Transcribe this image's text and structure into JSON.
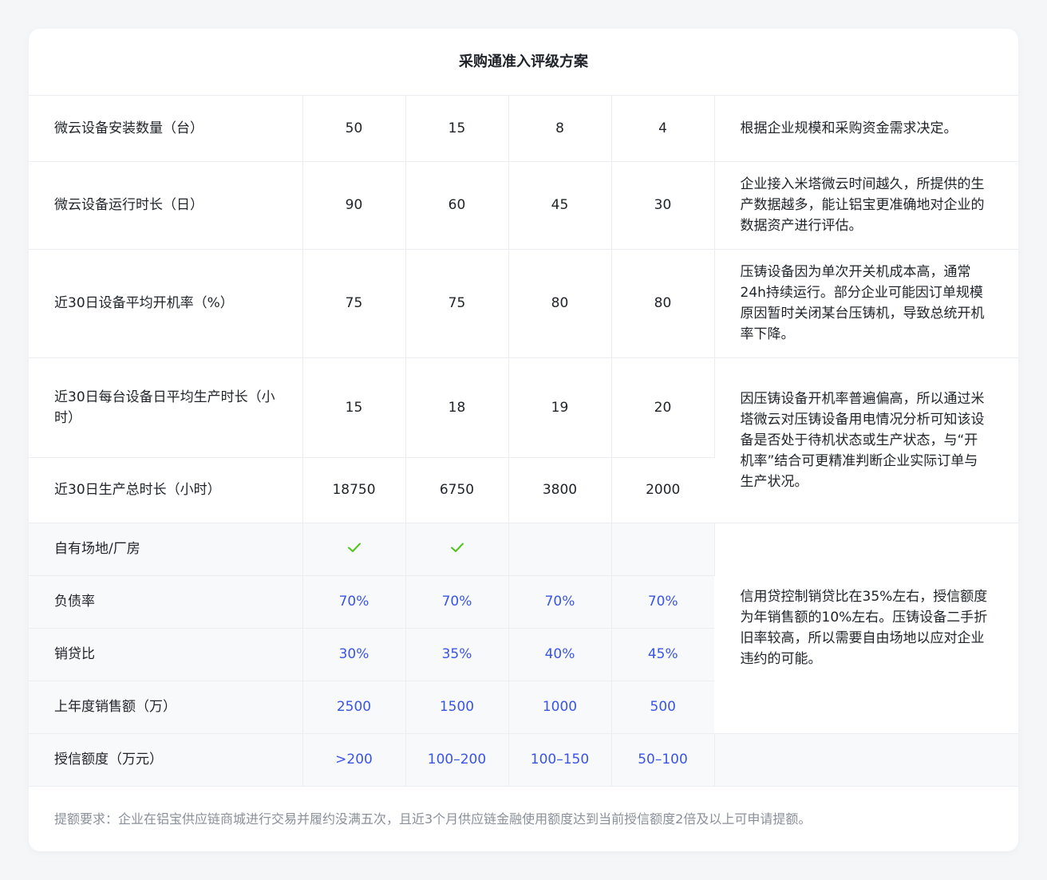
{
  "title": "采购通准入评级方案",
  "rows": {
    "install_count": {
      "label": "微云设备安装数量（台）",
      "values": [
        "50",
        "15",
        "8",
        "4"
      ],
      "note": "根据企业规模和采购资金需求决定。"
    },
    "run_days": {
      "label": "微云设备运行时长（日）",
      "values": [
        "90",
        "60",
        "45",
        "30"
      ],
      "note": "企业接入米塔微云时间越久，所提供的生产数据越多，能让铝宝更准确地对企业的数据资产进行评估。"
    },
    "uptime": {
      "label": "近30日设备平均开机率（%）",
      "values": [
        "75",
        "75",
        "80",
        "80"
      ],
      "note": "压铸设备因为单次开关机成本高，通常24h持续运行。部分企业可能因订单规模原因暂时关闭某台压铸机，导致总统开机率下降。"
    },
    "daily_hours": {
      "label": "近30日每台设备日平均生产时长（小时）",
      "values": [
        "15",
        "18",
        "19",
        "20"
      ]
    },
    "total_hours": {
      "label": "近30日生产总时长（小时）",
      "values": [
        "18750",
        "6750",
        "3800",
        "2000"
      ]
    },
    "hours_note": "因压铸设备开机率普遍偏高，所以通过米塔微云对压铸设备用电情况分析可知该设备是否处于待机状态或生产状态，与“开机率”结合可更精准判断企业实际订单与生产状况。",
    "own_site": {
      "label": "自有场地/厂房",
      "checks": [
        true,
        true,
        false,
        false
      ]
    },
    "debt_ratio": {
      "label": "负债率",
      "values": [
        "70%",
        "70%",
        "70%",
        "70%"
      ]
    },
    "loan_ratio": {
      "label": "销贷比",
      "values": [
        "30%",
        "35%",
        "40%",
        "45%"
      ]
    },
    "last_year_sales": {
      "label": "上年度销售额（万）",
      "values": [
        "2500",
        "1500",
        "1000",
        "500"
      ]
    },
    "finance_note": "信用贷控制销贷比在35%左右，授信额度为年销售额的10%左右。压铸设备二手折旧率较高，所以需要自由场地以应对企业违约的可能。",
    "credit_limit": {
      "label": "授信额度（万元）",
      "values": [
        ">200",
        "100–200",
        "100–150",
        "50–100"
      ]
    }
  },
  "footer": "提额要求：企业在铝宝供应链商城进行交易并履约没满五次，且近3个月供应链金融使用额度达到当前授信额度2倍及以上可申请提额。",
  "colors": {
    "accent_blue": "#3a55e4",
    "check_green": "#52c41a"
  }
}
